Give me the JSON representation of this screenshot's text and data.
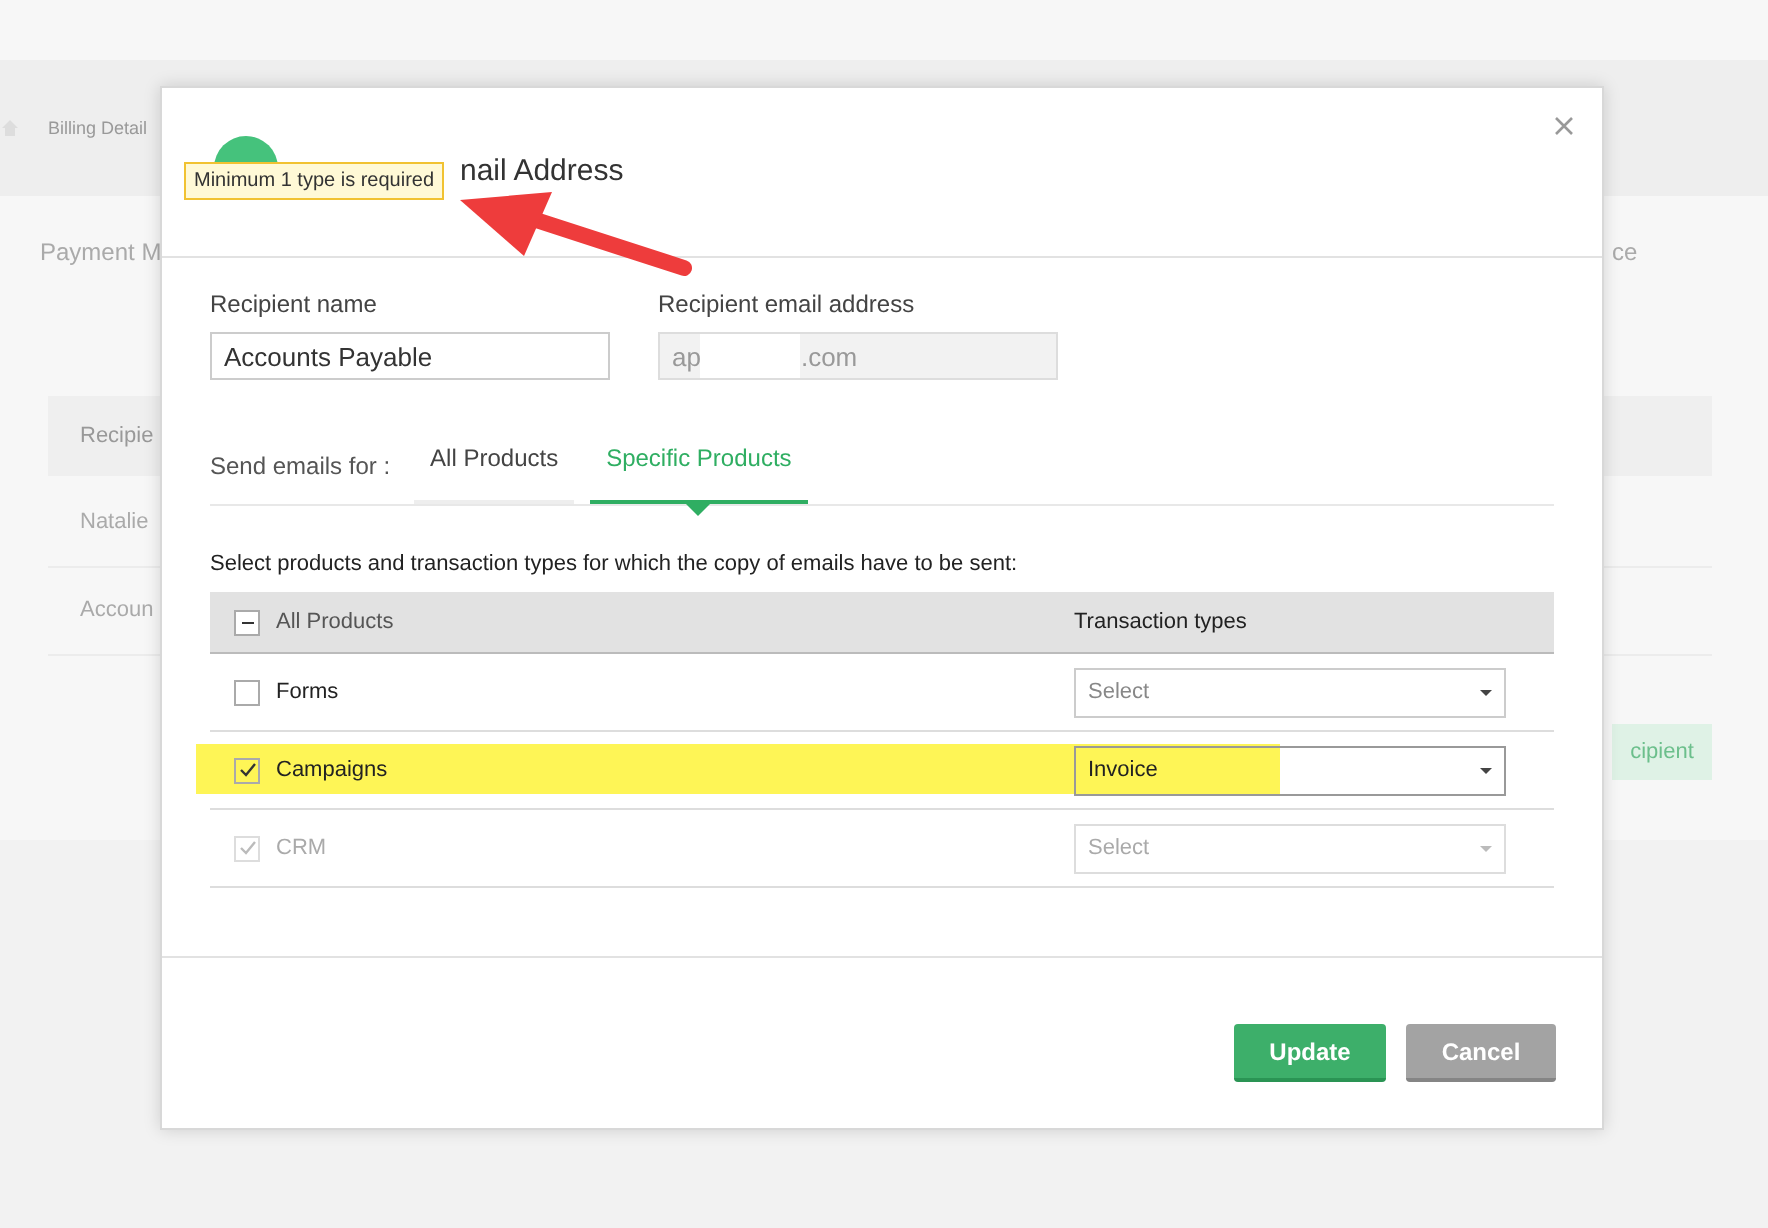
{
  "background_page": {
    "breadcrumb": "Billing Detail",
    "section_title": "Payment M",
    "section_title_right": "ce",
    "table_header": "Recipie",
    "rows": [
      "Natalie",
      "Accoun"
    ],
    "button": "cipient"
  },
  "dialog": {
    "title": "nail Address",
    "fields": [
      {
        "label": "Recipient name",
        "value": "Accounts Payable",
        "disabled": false
      },
      {
        "label": "Recipient email address",
        "value_start": "ap",
        "value_end": ".com",
        "disabled": true
      }
    ],
    "send_for_label": "Send emails for :",
    "tabs": [
      {
        "label": "All Products",
        "selected": false
      },
      {
        "label": "Specific Products",
        "selected": true
      }
    ],
    "instruction": "Select products and transaction types for which the copy of emails have to be sent:",
    "table": {
      "columns": [
        {
          "label": "All Products",
          "indeterminate": true
        },
        {
          "label": "Transaction types"
        }
      ],
      "rows": [
        {
          "product": "Forms",
          "checked": false,
          "disabled": false,
          "type": "Select",
          "placeholder": true,
          "highlighted": false
        },
        {
          "product": "Campaigns",
          "checked": true,
          "disabled": false,
          "type": "Invoice",
          "placeholder": false,
          "highlighted": true
        },
        {
          "product": "CRM",
          "checked": true,
          "disabled": true,
          "type": "Select",
          "placeholder": true,
          "highlighted": false
        }
      ]
    },
    "buttons": [
      {
        "label": "Update",
        "kind": "primary"
      },
      {
        "label": "Cancel",
        "kind": "secondary"
      }
    ]
  },
  "tooltip": "Minimum 1 type is required"
}
